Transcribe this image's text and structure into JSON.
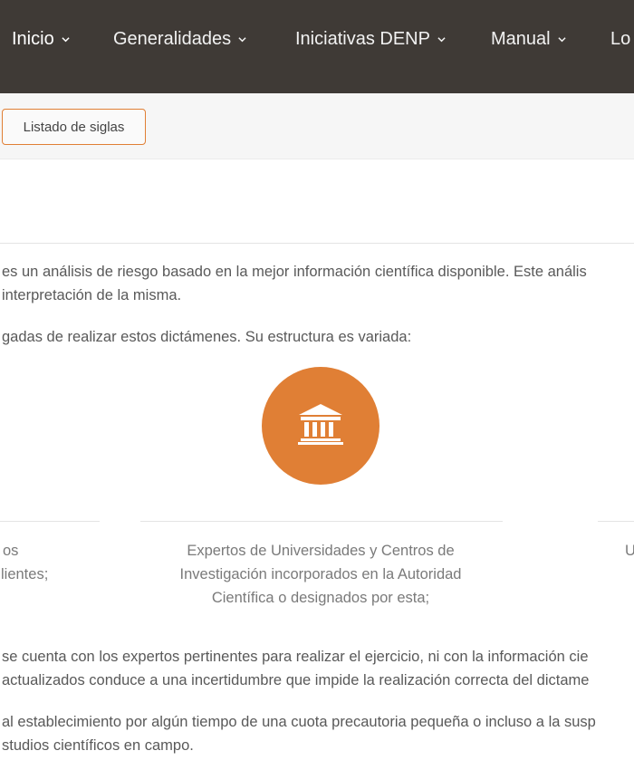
{
  "nav": {
    "items": [
      {
        "label": "Inicio"
      },
      {
        "label": "Generalidades"
      },
      {
        "label": "Iniciativas DENP"
      },
      {
        "label": "Manual"
      },
      {
        "label": "Lo"
      }
    ]
  },
  "toolbar": {
    "siglas_label": "Listado de siglas"
  },
  "content": {
    "intro_line1": "es un análisis de riesgo basado en la mejor información científica disponible. Este anális",
    "intro_line2": "interpretación de la misma.",
    "structure_line": "gadas de realizar estos dictámenes. Su estructura es variada:",
    "icon": "institution-icon",
    "accent_color": "#e07f35",
    "columns": {
      "left_line1": "os",
      "left_line2": "lientes;",
      "center_line1": "Expertos de Universidades y Centros de",
      "center_line2": "Investigación incorporados en la Autoridad",
      "center_line3": "Científica o designados por esta;",
      "right_line1": "U"
    },
    "para2_line1": "se cuenta con los expertos pertinentes para realizar el ejercicio, ni con la información cie",
    "para2_line2": "actualizados conduce a una incertidumbre que impide la realización correcta del dictame",
    "para3_line1": "al establecimiento por algún tiempo de una cuota precautoria pequeña o incluso a la susp",
    "para3_line2": "studios científicos en campo."
  }
}
